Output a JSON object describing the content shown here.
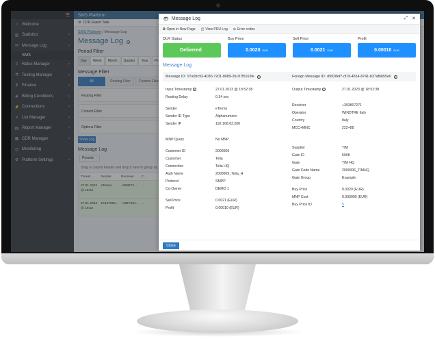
{
  "sidebar": {
    "items": [
      {
        "icon": "house-icon",
        "label": "Welcome"
      },
      {
        "icon": "chart-icon",
        "label": "Statistics"
      },
      {
        "icon": "envelope-icon",
        "label": "Message Log"
      },
      {
        "icon": "sms-icon",
        "label": "SMS",
        "sub": true
      },
      {
        "icon": "list-icon",
        "label": "Rates Manager"
      },
      {
        "icon": "flask-icon",
        "label": "Testing Manager"
      },
      {
        "icon": "coins-icon",
        "label": "Finance"
      },
      {
        "icon": "billing-icon",
        "label": "Billing Conditions"
      },
      {
        "icon": "plug-icon",
        "label": "Connections"
      },
      {
        "icon": "list-icon",
        "label": "List Manager"
      },
      {
        "icon": "report-icon",
        "label": "Report Manager"
      },
      {
        "icon": "cdr-icon",
        "label": "CDR Manager"
      },
      {
        "icon": "monitor-icon",
        "label": "Monitoring"
      },
      {
        "icon": "gear-icon",
        "label": "Platform Settings"
      }
    ]
  },
  "app": {
    "title": "SMS Platform",
    "cdr_export": "CDR Export Task",
    "breadcrumb": {
      "root": "SMS Platform",
      "sep": "/",
      "current": "Message Log"
    },
    "page_title": "Message Log",
    "period_filter": "Period Filter",
    "periods": [
      "Day",
      "Week",
      "Month",
      "Quarter",
      "Year",
      "Period"
    ],
    "message_filter": "Message Filter",
    "mf_tabs": [
      "All",
      "Routing Filter",
      "Content Filter"
    ],
    "filters": [
      "Routing Filter",
      "Content Filter",
      "Options Filter"
    ],
    "show_log": "Show Log",
    "message_log": "Message Log",
    "presets": "Presets",
    "drag_hint": "Drag a column header and drop it here to group by that column",
    "grid_cols": [
      "Timest...",
      "Sender",
      "Receiver",
      "C..."
    ],
    "grid_rows": [
      [
        "27.01.2023 @ 18:52",
        "eTermo",
        "+393872...",
        "..."
      ],
      [
        "27.01.2023 @ 18:52",
        "14157553...",
        "+4917634...",
        "..."
      ]
    ]
  },
  "modal": {
    "title": "Message Log",
    "tools": [
      {
        "icon": "external-icon",
        "label": "Open in New Page"
      },
      {
        "icon": "pdu-icon",
        "label": "View PDU Log"
      },
      {
        "icon": "error-icon",
        "label": "Error codes"
      }
    ],
    "kpis": [
      {
        "label": "DLR Status",
        "value": "Delivered",
        "unit": "",
        "color": "#5cc85a"
      },
      {
        "label": "Buy Price",
        "value": "0.0020",
        "unit": "EUR",
        "color": "#1e90ff"
      },
      {
        "label": "Sell Price",
        "value": "0.0021",
        "unit": "EUR",
        "color": "#1e90ff"
      },
      {
        "label": "Profit",
        "value": "0.00010",
        "unit": "EUR",
        "color": "#1e90ff"
      }
    ],
    "section": "Message Log",
    "message_id_label": "Message ID:",
    "message_id": "97a99c93-4030-7201-8089-2b107f5163fe",
    "foreign_id_label": "Foreign Message ID:",
    "foreign_id": "d9928ef7-cf19-4814-8741-b37af6b55e0",
    "left": [
      {
        "k": "Input Timestamp",
        "v": "27.01.2023 @ 18:52:38",
        "info": true
      },
      {
        "k": "Routing Delay",
        "v": "0.34  sec"
      },
      {
        "gap": true
      },
      {
        "k": "Sender",
        "v": "eTermo"
      },
      {
        "k": "Sender ID Type",
        "v": "Alphanumeric"
      },
      {
        "k": "Sender IP",
        "v": "192.168.63.200"
      },
      {
        "gap": true
      },
      {
        "gap": true
      },
      {
        "k": "MNP Query",
        "v": "No MNP"
      },
      {
        "gap": true
      },
      {
        "k": "Customer ID",
        "v": "2000009"
      },
      {
        "k": "Customer",
        "v": "Telia"
      },
      {
        "k": "Connection",
        "v": "Telia HQ"
      },
      {
        "k": "Auth Name",
        "v": "2000009_Telia_H"
      },
      {
        "k": "Protocol",
        "v": "SMPP"
      },
      {
        "k": "Co-Owner",
        "v": "DEMO 1"
      },
      {
        "gap": true
      },
      {
        "k": "Sell Price",
        "v": "0.0021  (EUR)"
      },
      {
        "k": "Profit",
        "v": "0.00010  (EUR)"
      }
    ],
    "right": [
      {
        "k": "Output Timestamp",
        "v": "27.01.2023 @ 18:52:38",
        "info": true
      },
      {
        "gap": true
      },
      {
        "gap": true
      },
      {
        "k": "Receiver",
        "v": "+393807271"
      },
      {
        "k": "Operator",
        "v": "WINDTRE Italy"
      },
      {
        "k": "Country",
        "v": "Italy"
      },
      {
        "k": "MCC+MNC",
        "v": "222+88"
      },
      {
        "gap": true
      },
      {
        "gap": true
      },
      {
        "gap": true
      },
      {
        "k": "Supplier",
        "v": "TIM"
      },
      {
        "k": "Gate ID",
        "v": "5008"
      },
      {
        "k": "Gate",
        "v": "TIM HQ"
      },
      {
        "k": "Gate Code Name",
        "v": "2000006_TIMHQ"
      },
      {
        "k": "Gate Group",
        "v": "Example"
      },
      {
        "gap": true
      },
      {
        "k": "Buy Price",
        "v": "0.0020  (EUR)"
      },
      {
        "k": "MNP Cost",
        "v": "0.000000  (EUR)"
      },
      {
        "k": "Buy Price ID",
        "v": "5",
        "link": true
      }
    ],
    "close": "Close"
  }
}
